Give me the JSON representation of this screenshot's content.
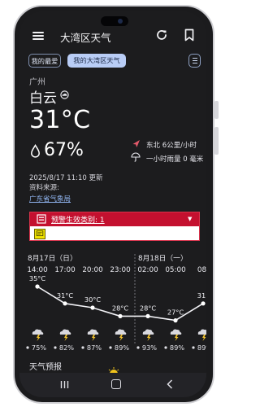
{
  "app": {
    "title": "大湾区天气"
  },
  "icons": {
    "menu": "menu-icon",
    "refresh": "refresh-icon",
    "bookmark": "bookmark-icon",
    "list": "list-icon",
    "condition": "cloud-icon",
    "humidity": "raindrop-icon",
    "wind": "wind-direction-icon",
    "rain": "umbrella-icon",
    "alert": "warning-icon"
  },
  "tabs": [
    {
      "label": "我的最爱",
      "selected": false
    },
    {
      "label": "我的大湾区天气",
      "selected": true
    }
  ],
  "current": {
    "city": "广州",
    "condition": "白云",
    "temperature": "31°C",
    "humidity": "67%",
    "wind": "东北 6公里/小时",
    "rainfall": "一小时雨量 0 毫米",
    "updated": "2025/8/17 11:10 更新",
    "source_label": "资料来源:",
    "source_name": "广东省气象局"
  },
  "alert": {
    "label": "预警生效类别: 1",
    "arrow": "▼",
    "color": "#c4102f"
  },
  "forecast": {
    "dates": [
      "8月17日（日）",
      "8月18日（一）"
    ],
    "times": [
      "14:00",
      "17:00",
      "20:00",
      "23:00",
      "02:00",
      "05:00",
      "08:"
    ],
    "temperatures": [
      "35°C",
      "31°C",
      "30°C",
      "28°C",
      "28°C",
      "27°C",
      "31°"
    ],
    "temperature_values": [
      35,
      31,
      30,
      28,
      28,
      27,
      31
    ],
    "rain_probability": [
      "75%",
      "82%",
      "87%",
      "89%",
      "93%",
      "89%",
      "89%"
    ],
    "icons": [
      "thunderstorm-icon",
      "thunderstorm-icon",
      "thunderstorm-icon",
      "thunderstorm-icon",
      "thunderstorm-icon",
      "thunderstorm-icon",
      "thunderstorm-icon"
    ]
  },
  "section": {
    "title": "天气预报"
  },
  "colors": {
    "background": "#1c1c1e",
    "accent": "#b9cdf6",
    "alert_red": "#c4102f",
    "link": "#8fb3ee"
  }
}
